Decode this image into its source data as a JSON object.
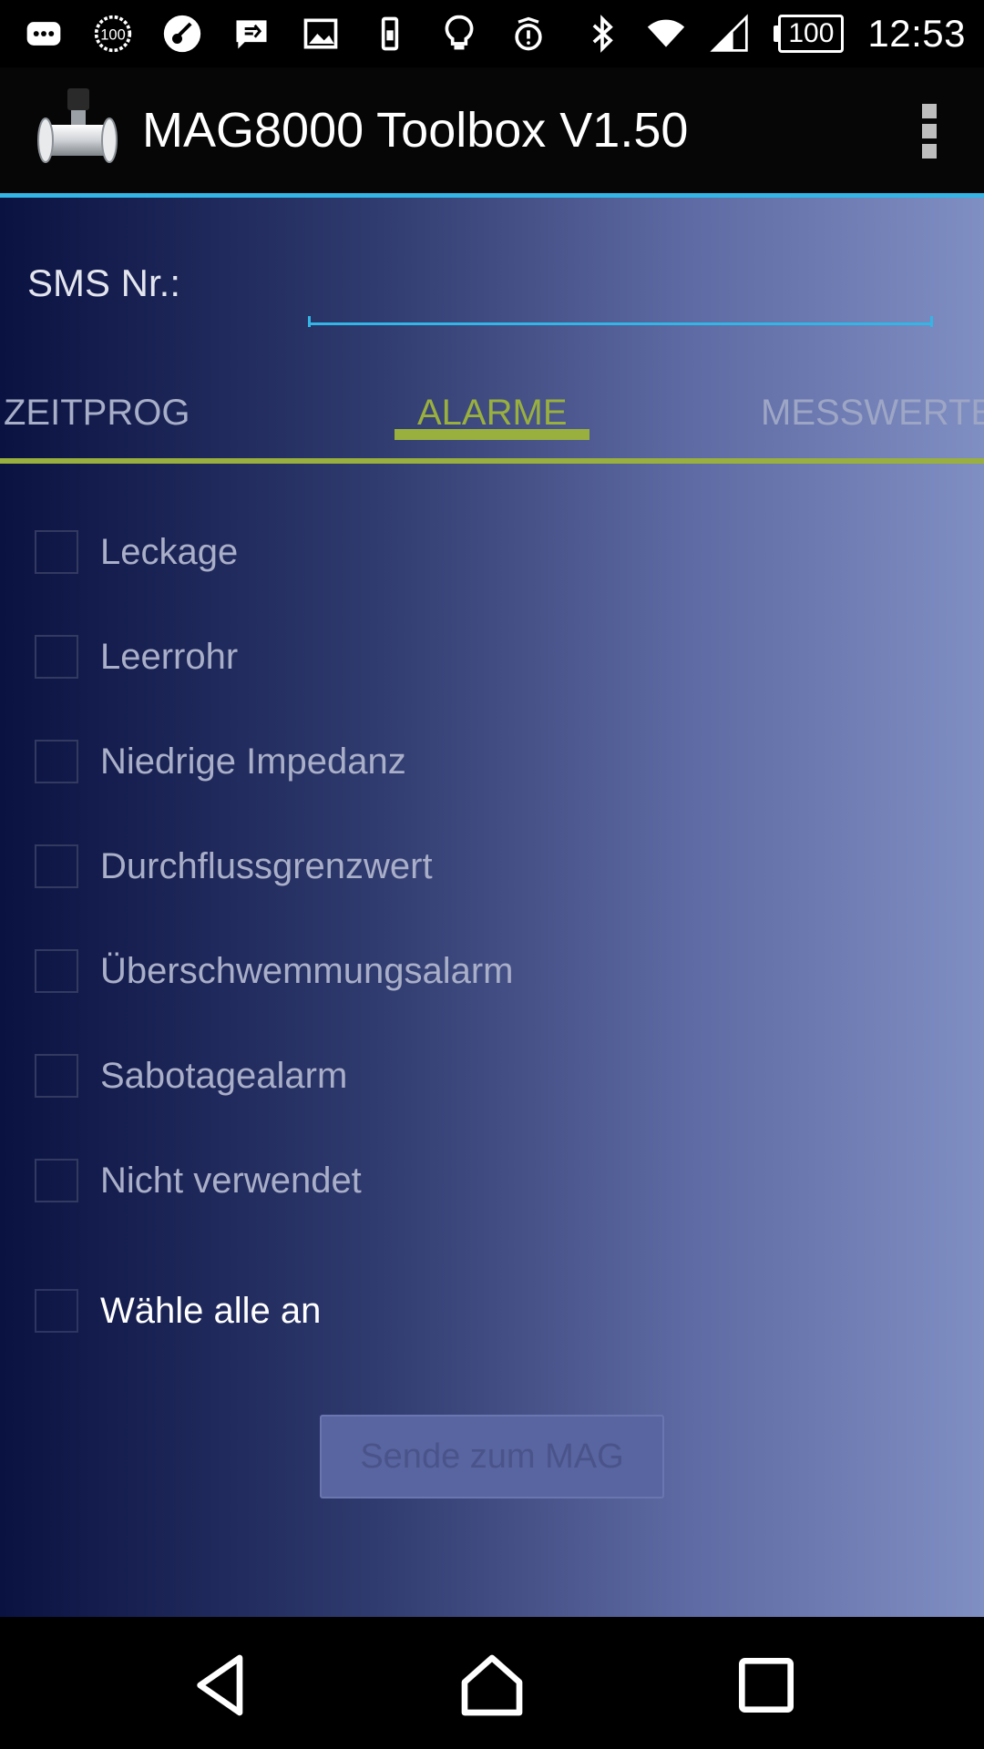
{
  "status_bar": {
    "battery_level": "100",
    "time": "12:53",
    "icons": [
      "chat-bubble-icon",
      "ring-100-icon",
      "guitar-icon",
      "chat-arrow-icon",
      "image-icon",
      "phone-vibrate-icon",
      "lightbulb-icon",
      "alert-icon",
      "bluetooth-icon",
      "wifi-icon",
      "signal-icon",
      "battery-icon"
    ]
  },
  "action_bar": {
    "title": "MAG8000 Toolbox V1.50"
  },
  "form": {
    "sms_label": "SMS Nr.:",
    "sms_value": ""
  },
  "tabs": {
    "prev": "ZEITPROG",
    "active": "ALARME",
    "next": "MESSWERTE"
  },
  "alarms": {
    "items": [
      {
        "label": "Leckage",
        "checked": false
      },
      {
        "label": "Leerrohr",
        "checked": false
      },
      {
        "label": "Niedrige Impedanz",
        "checked": false
      },
      {
        "label": "Durchflussgrenzwert",
        "checked": false
      },
      {
        "label": "Überschwemmungsalarm",
        "checked": false
      },
      {
        "label": "Sabotagealarm",
        "checked": false
      },
      {
        "label": "Nicht verwendet",
        "checked": false
      }
    ],
    "select_all": "Wähle alle an",
    "send_button": "Sende zum MAG"
  },
  "colors": {
    "accent_green": "#99b03e",
    "accent_blue": "#33b5e5"
  }
}
